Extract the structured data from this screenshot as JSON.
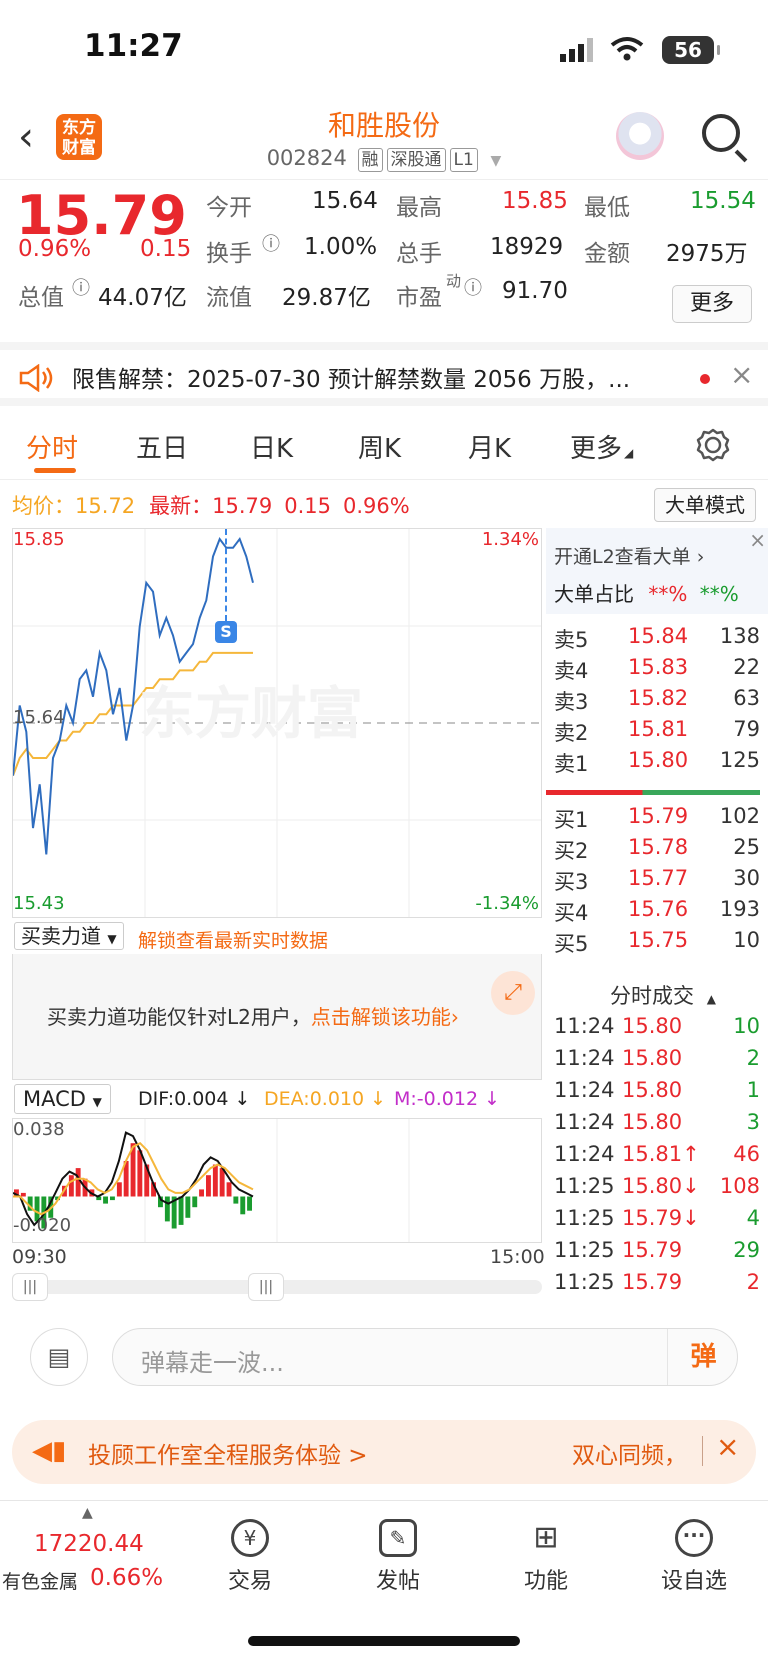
{
  "status_bar": {
    "time": "11:27",
    "battery": "56"
  },
  "header": {
    "logo_text": "东方财富",
    "stock_name": "和胜股份",
    "stock_code": "002824",
    "tags": [
      "融",
      "深股通",
      "L1"
    ]
  },
  "quote": {
    "price": "15.79",
    "change_pct": "0.96%",
    "change": "0.15",
    "open_label": "今开",
    "open": "15.64",
    "high_label": "最高",
    "high": "15.85",
    "low_label": "最低",
    "low": "15.54",
    "turnover_label": "换手",
    "turnover": "1.00%",
    "volume_label": "总手",
    "volume": "18929",
    "amount_label": "金额",
    "amount": "2975万",
    "mktcap_label": "总值",
    "mktcap": "44.07亿",
    "float_label": "流值",
    "float_cap": "29.87亿",
    "pe_label": "市盈",
    "pe_sup": "动",
    "pe": "91.70",
    "more_label": "更多"
  },
  "notice": {
    "text": "限售解禁：2025-07-30 预计解禁数量 2056 万股，..."
  },
  "tabs": [
    "分时",
    "五日",
    "日K",
    "周K",
    "月K",
    "更多"
  ],
  "chart": {
    "avg_label": "均价：",
    "avg": "15.72",
    "latest_label": "最新：",
    "latest": "15.79",
    "latest_change": "0.15",
    "latest_pct": "0.96%",
    "big_order_mode": "大单模式",
    "price_max": "15.85",
    "price_min": "15.43",
    "prev_close": "15.64",
    "pct_max": "1.34%",
    "pct_min": "-1.34%",
    "watermark": "东方财富",
    "marker": "S",
    "indicator_select": "买卖力道",
    "unlock_link": "解锁查看最新实时数据",
    "l2_notice": "买卖力道功能仅针对L2用户，",
    "l2_unlock": "点击解锁该功能",
    "macd_select": "MACD",
    "dif": "DIF:0.004 ↓",
    "dea": "DEA:0.010 ↓",
    "m": "M:-0.012 ↓",
    "macd_max": "0.038",
    "macd_min": "-0.020",
    "time_start": "09:30",
    "time_end": "15:00"
  },
  "chart_data": {
    "type": "line",
    "series": [
      {
        "name": "最新",
        "values": [
          15.58,
          15.66,
          15.63,
          15.52,
          15.57,
          15.49,
          15.6,
          15.62,
          15.66,
          15.64,
          15.69,
          15.7,
          15.67,
          15.72,
          15.7,
          15.65,
          15.68,
          15.62,
          15.66,
          15.75,
          15.8,
          15.79,
          15.74,
          15.76,
          15.74,
          15.71,
          15.72,
          15.73,
          15.76,
          15.78,
          15.83,
          15.85,
          15.84,
          15.84,
          15.85,
          15.83,
          15.8
        ]
      },
      {
        "name": "均价",
        "values": [
          15.58,
          15.6,
          15.61,
          15.6,
          15.6,
          15.6,
          15.61,
          15.62,
          15.62,
          15.63,
          15.63,
          15.64,
          15.64,
          15.65,
          15.65,
          15.66,
          15.66,
          15.66,
          15.66,
          15.67,
          15.68,
          15.68,
          15.69,
          15.69,
          15.69,
          15.7,
          15.7,
          15.7,
          15.71,
          15.71,
          15.72,
          15.72,
          15.72,
          15.72,
          15.72,
          15.72,
          15.72
        ]
      }
    ],
    "ylim": [
      15.43,
      15.85
    ],
    "x_range": [
      "09:30",
      "15:00"
    ]
  },
  "order_book": {
    "header": "开通L2查看大单 ›",
    "big_ratio_label": "大单占比",
    "big_ratio_buy": "**%",
    "big_ratio_sell": "**%",
    "sells": [
      {
        "label": "卖5",
        "price": "15.84",
        "vol": "138"
      },
      {
        "label": "卖4",
        "price": "15.83",
        "vol": "22"
      },
      {
        "label": "卖3",
        "price": "15.82",
        "vol": "63"
      },
      {
        "label": "卖2",
        "price": "15.81",
        "vol": "79"
      },
      {
        "label": "卖1",
        "price": "15.80",
        "vol": "125"
      }
    ],
    "buys": [
      {
        "label": "买1",
        "price": "15.79",
        "vol": "102"
      },
      {
        "label": "买2",
        "price": "15.78",
        "vol": "25"
      },
      {
        "label": "买3",
        "price": "15.77",
        "vol": "30"
      },
      {
        "label": "买4",
        "price": "15.76",
        "vol": "193"
      },
      {
        "label": "买5",
        "price": "15.75",
        "vol": "10"
      }
    ],
    "trades_header": "分时成交",
    "trades": [
      {
        "time": "11:24",
        "price": "15.80",
        "vol": "10",
        "dir": "buy"
      },
      {
        "time": "11:24",
        "price": "15.80",
        "vol": "2",
        "dir": "buy"
      },
      {
        "time": "11:24",
        "price": "15.80",
        "vol": "1",
        "dir": "buy"
      },
      {
        "time": "11:24",
        "price": "15.80",
        "vol": "3",
        "dir": "buy"
      },
      {
        "time": "11:24",
        "price": "15.81↑",
        "vol": "46",
        "dir": "sell"
      },
      {
        "time": "11:25",
        "price": "15.80↓",
        "vol": "108",
        "dir": "sell"
      },
      {
        "time": "11:25",
        "price": "15.79↓",
        "vol": "4",
        "dir": "buy"
      },
      {
        "time": "11:25",
        "price": "15.79",
        "vol": "29",
        "dir": "buy"
      },
      {
        "time": "11:25",
        "price": "15.79",
        "vol": "2",
        "dir": "sell"
      }
    ]
  },
  "danmu": {
    "placeholder": "弹幕走一波...",
    "send_label": "弹"
  },
  "promo": {
    "left": "投顾工作室全程服务体验 >",
    "right": "双心同频，"
  },
  "bottom_nav": {
    "index_value": "17220.44",
    "index_name": "有色金属",
    "index_pct": "0.66%",
    "items": [
      {
        "label": "交易",
        "icon": "yen-icon"
      },
      {
        "label": "发帖",
        "icon": "edit-icon"
      },
      {
        "label": "功能",
        "icon": "grid-icon"
      },
      {
        "label": "设自选",
        "icon": "more-icon"
      }
    ]
  },
  "colors": {
    "up": "#e8282d",
    "down": "#1a9c2f",
    "brand": "#f46a14",
    "price_line": "#2f6dbf",
    "avg_line": "#f5b73b"
  }
}
